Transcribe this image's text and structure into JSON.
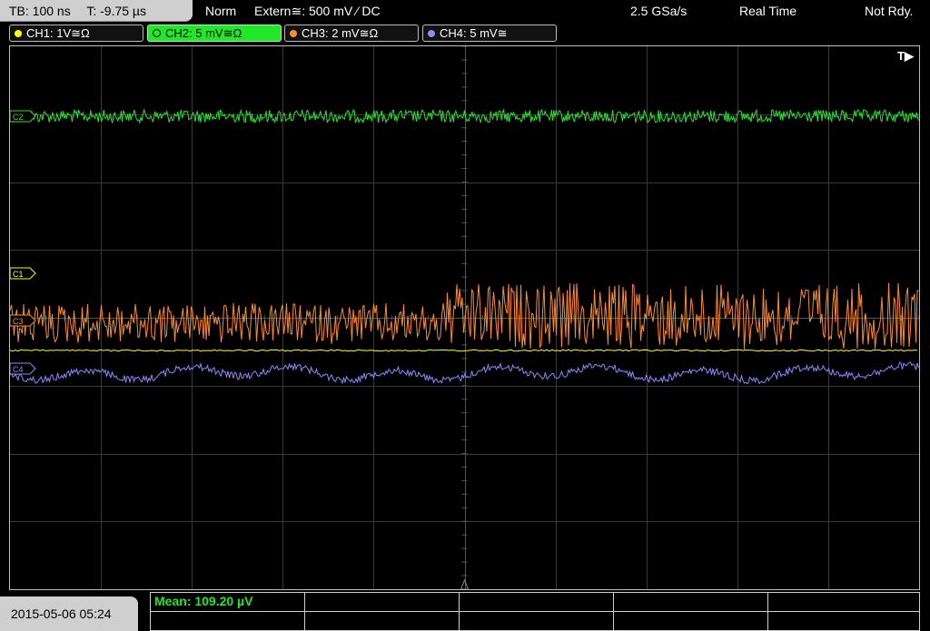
{
  "timebase": {
    "tb": "TB: 100 ns",
    "trigger_time": "T: -9.75 µs"
  },
  "status": {
    "mode": "Norm",
    "trigger": "Extern≅: 500 mV ⁄ DC",
    "sample_rate": "2.5 GSa/s",
    "acq_mode": "Real Time",
    "ready": "Not Rdy."
  },
  "channels": [
    {
      "label": "CH1: 1V≅Ω",
      "color": "#ffff00",
      "marker": "C1"
    },
    {
      "label": "CH2: 5 mV≅Ω",
      "color": "#22e62a",
      "marker": "C2"
    },
    {
      "label": "CH3: 2 mV≅Ω",
      "color": "#ff8a2a",
      "marker": "C3"
    },
    {
      "label": "CH4: 5 mV≅",
      "color": "#8a8aff",
      "marker": "C4"
    }
  ],
  "trigger_marker": "T▶",
  "datetime": "2015-05-06 05:24",
  "measurement": {
    "mean": "Mean: 109.20 µV"
  }
}
